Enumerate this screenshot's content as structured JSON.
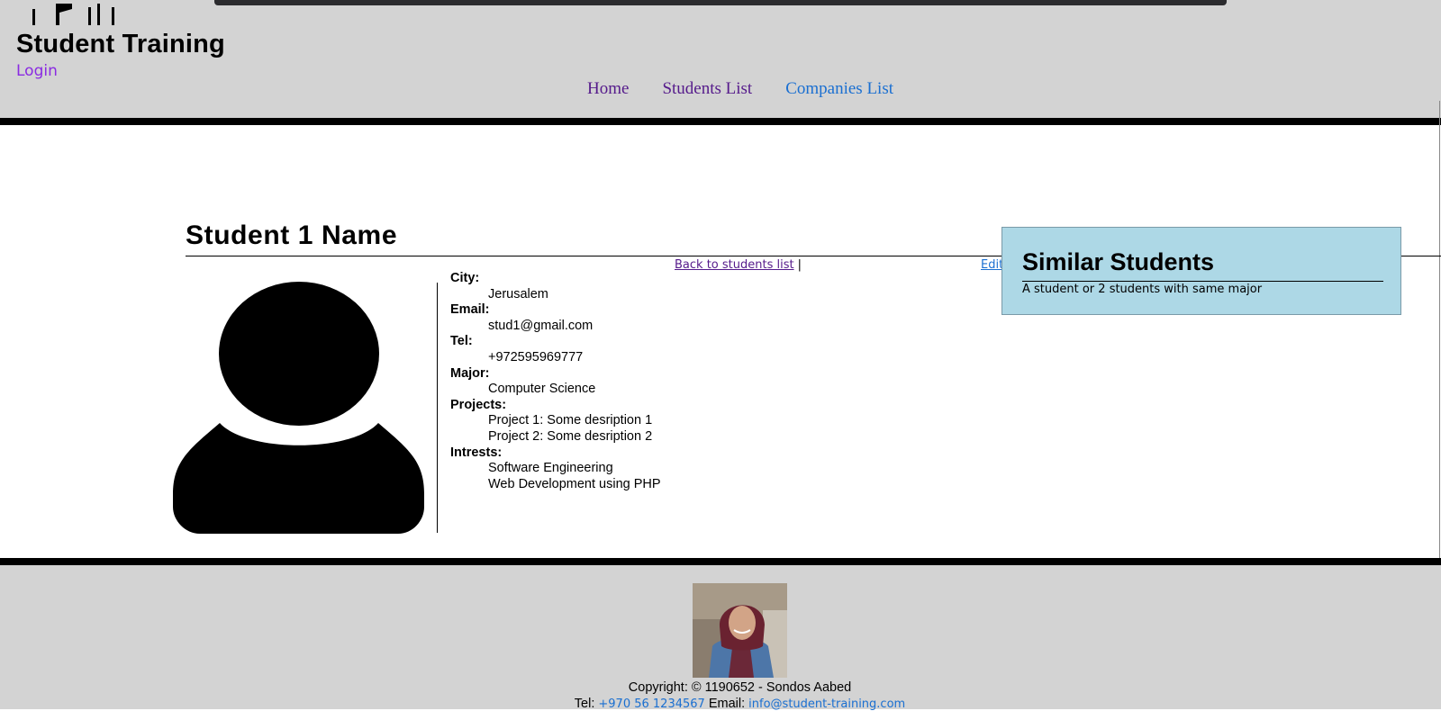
{
  "header": {
    "site_title": "Student Training",
    "login_label": "Login",
    "nav": [
      {
        "label": "Home"
      },
      {
        "label": "Students List"
      },
      {
        "label": "Companies List"
      }
    ]
  },
  "student": {
    "name": "Student 1 Name",
    "back_label": "Back to students list",
    "separator": "|",
    "edit_label": "Edit",
    "fields": {
      "city_label": "City:",
      "city": "Jerusalem",
      "email_label": "Email:",
      "email": "stud1@gmail.com",
      "tel_label": "Tel:",
      "tel": "+972595969777",
      "major_label": "Major:",
      "major": "Computer Science",
      "projects_label": "Projects:",
      "projects": [
        "Project 1: Some desription 1",
        "Project 2: Some desription 2"
      ],
      "interests_label": "Intrests:",
      "interests": [
        "Software Engineering",
        "Web Development using PHP"
      ]
    }
  },
  "similar": {
    "title": "Similar Students",
    "description": "A student or 2 students with same major"
  },
  "footer": {
    "copyright": "Copyright: © 1190652 - Sondos Aabed",
    "tel_label": "Tel:",
    "tel": "+970 56 1234567",
    "email_label": "Email:",
    "email": "info@student-training.com"
  },
  "colors": {
    "header_bg": "#d3d3d3",
    "similar_bg": "#add8e6",
    "link": "#1a6fd1",
    "visited_link": "#551a8b",
    "login": "#8a2be2"
  },
  "icons": [
    "logo-icon",
    "avatar-icon",
    "footer-photo"
  ]
}
